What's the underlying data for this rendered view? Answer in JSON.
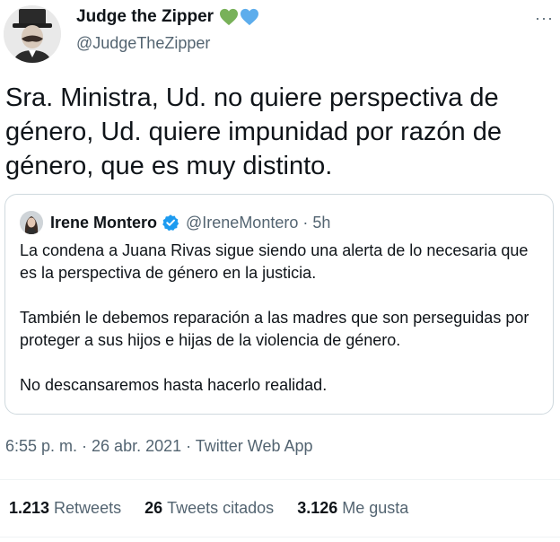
{
  "author": {
    "name": "Judge the Zipper",
    "handle": "@JudgeTheZipper",
    "hearts": [
      "green-heart",
      "blue-heart"
    ]
  },
  "more_label": "···",
  "tweet": {
    "text": "Sra. Ministra, Ud. no quiere perspectiva de\ngénero, Ud. quiere impunidad por razón de\ngénero, que es muy distinto."
  },
  "quoted": {
    "name": "Irene Montero",
    "verified": true,
    "handle": "@IreneMontero",
    "separator": "·",
    "time": "5h",
    "paragraphs": [
      "La condena a Juana Rivas sigue siendo una alerta de lo necesaria que es la perspectiva de género en la justicia.",
      "También le debemos reparación a las madres que son perseguidas por proteger a sus hijos e hijas de la violencia de género.",
      "No descansaremos hasta hacerlo realidad."
    ]
  },
  "meta": {
    "timestamp": "6:55 p. m. · 26 abr. 2021 · Twitter Web App"
  },
  "stats": {
    "retweets": {
      "count": "1.213",
      "label": "Retweets"
    },
    "quotes": {
      "count": "26",
      "label": "Tweets citados"
    },
    "likes": {
      "count": "3.126",
      "label": "Me gusta"
    }
  },
  "colors": {
    "primary_text": "#0f1419",
    "secondary_text": "#536471",
    "border": "#cfd9de",
    "verified": "#1d9bf0",
    "green_heart": "#78b159",
    "blue_heart": "#5dadec"
  }
}
